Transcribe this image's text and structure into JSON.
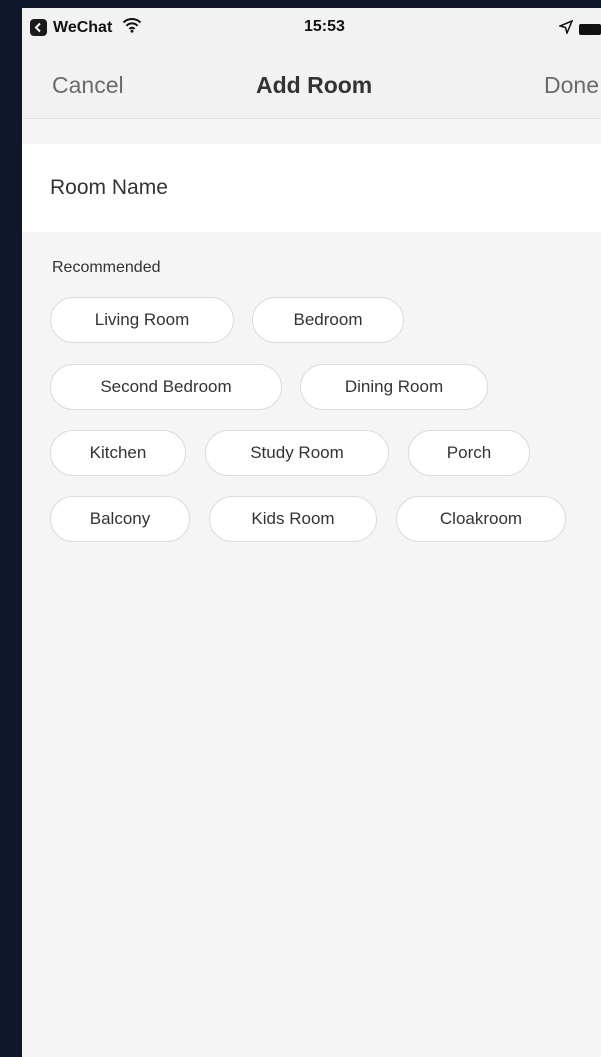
{
  "status_bar": {
    "app_name": "WeChat",
    "time": "15:53"
  },
  "nav": {
    "cancel_label": "Cancel",
    "title": "Add Room",
    "done_label": "Done"
  },
  "room_name": {
    "placeholder": "Room Name",
    "value": ""
  },
  "recommended": {
    "label": "Recommended",
    "chips": [
      "Living Room",
      "Bedroom",
      "Second Bedroom",
      "Dining Room",
      "Kitchen",
      "Study Room",
      "Porch",
      "Balcony",
      "Kids Room",
      "Cloakroom"
    ]
  },
  "colors": {
    "page_background": "#f5f5f5",
    "outer_background": "#0f172a",
    "chip_border": "#dcdcdc",
    "text_primary": "#333333",
    "nav_action": "#6b6b6b"
  },
  "icons": {
    "status_left": "back-app-icon",
    "signal": "wifi-icon",
    "location": "location-arrow-icon",
    "battery": "battery-icon"
  }
}
